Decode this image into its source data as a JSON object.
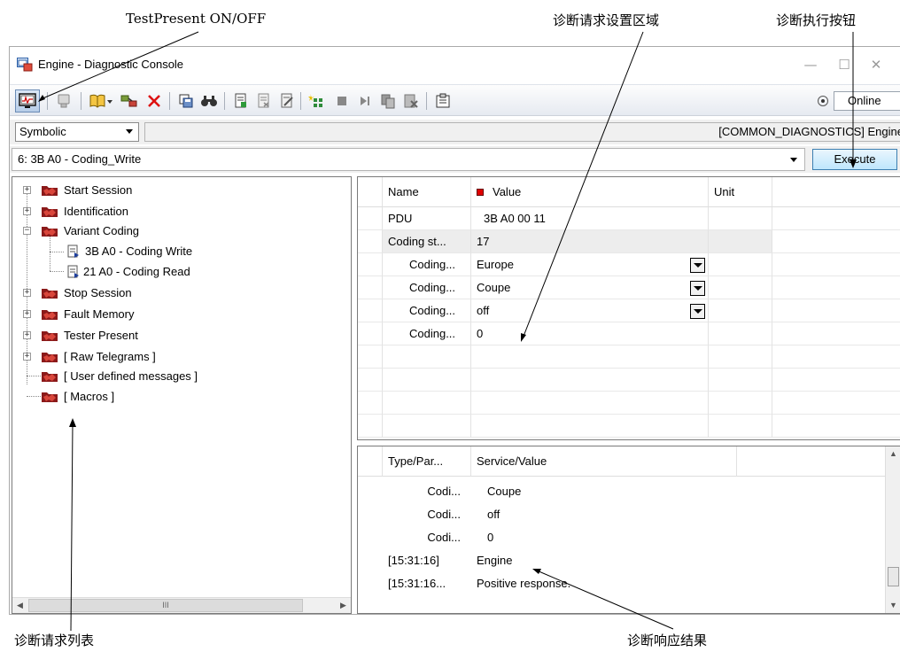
{
  "annotations": {
    "testpresent": "TestPresent ON/OFF",
    "settings_area": "诊断请求设置区域",
    "execute_button": "诊断执行按钮",
    "request_list": "诊断请求列表",
    "response_result": "诊断响应结果"
  },
  "window": {
    "title": "Engine - Diagnostic Console",
    "minimize": "—",
    "maximize": "☐",
    "close": "✕"
  },
  "toolbar": {
    "icons": [
      "testpresent-icon",
      "trace-icon",
      "book-icon",
      "connect-icon",
      "delete-icon",
      "save-icon",
      "find-icon",
      "doc-add-icon",
      "doc-remove-icon",
      "doc-edit-icon",
      "macro-run-icon",
      "stop-icon",
      "step-icon",
      "copy-icon",
      "cancel-icon",
      "clipboard-icon"
    ],
    "status": "Online"
  },
  "mode": {
    "selected": "Symbolic"
  },
  "path": "[COMMON_DIAGNOSTICS] Engine",
  "request": {
    "selected": "6: 3B A0 - Coding_Write",
    "execute_label": "Execute"
  },
  "tree": {
    "items": [
      {
        "label": "Start Session"
      },
      {
        "label": "Identification"
      },
      {
        "label": "Variant Coding"
      },
      {
        "label": "3B A0 - Coding Write"
      },
      {
        "label": "21 A0 - Coding Read"
      },
      {
        "label": "Stop Session"
      },
      {
        "label": "Fault Memory"
      },
      {
        "label": "Tester Present"
      },
      {
        "label": "[ Raw Telegrams ]"
      },
      {
        "label": "[ User defined messages ]"
      },
      {
        "label": "[ Macros ]"
      }
    ],
    "scroll_thumb": "III"
  },
  "params": {
    "headers": [
      "Name",
      "Value",
      "Unit"
    ],
    "rows": [
      {
        "name": "PDU",
        "value": "3B A0 00 11"
      },
      {
        "name": "Coding st...",
        "value": "17"
      },
      {
        "name": "Coding...",
        "value": "Europe"
      },
      {
        "name": "Coding...",
        "value": "Coupe"
      },
      {
        "name": "Coding...",
        "value": "off"
      },
      {
        "name": "Coding...",
        "value": "0"
      }
    ]
  },
  "results": {
    "headers": [
      "Type/Par...",
      "Service/Value"
    ],
    "rows": [
      {
        "type": "Codi...",
        "value": "Coupe"
      },
      {
        "type": "Codi...",
        "value": "off"
      },
      {
        "type": "Codi...",
        "value": "0"
      },
      {
        "type": "[15:31:16]",
        "value": "Engine"
      },
      {
        "type": "[15:31:16...",
        "value": "Positive response."
      }
    ]
  }
}
